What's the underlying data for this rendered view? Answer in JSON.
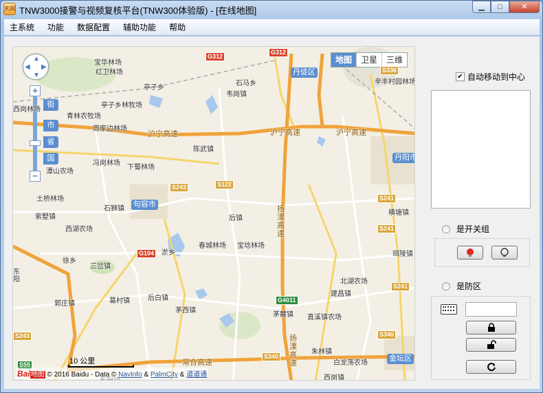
{
  "window": {
    "title": "TNW3000接警与视频复核平台(TNW300体验版) - [在线地图]",
    "app_icon_label": "天网",
    "controls": {
      "minimize": "▁",
      "maximize": "□",
      "close": "✕"
    }
  },
  "menu": [
    "主系统",
    "功能",
    "数据配置",
    "辅助功能",
    "帮助"
  ],
  "map": {
    "type_buttons": [
      "地图",
      "卫星",
      "三维"
    ],
    "active_type": "地图",
    "zoom_levels": [
      "街",
      "市",
      "省",
      "国"
    ],
    "zoom_in": "+",
    "zoom_out": "−",
    "scale_label": "10 公里",
    "copyright": {
      "logo": "Bai",
      "logo_suffix": "地图",
      "text": "© 2016 Baidu - Data ©",
      "links": [
        "NavInfo",
        "PalmCity",
        "道道通"
      ],
      "sep": "&"
    },
    "towns": [
      "丹徒区",
      "丹阳市",
      "句容市",
      "金坛区"
    ],
    "highways": [
      "沪宁高速",
      "沪宁高速",
      "沪宁高速",
      "扬溧高速",
      "扬溧高速",
      "常合高速"
    ],
    "road_shields": [
      "G312",
      "G312",
      "S336",
      "S243",
      "S122",
      "S241",
      "S241",
      "S241",
      "G104",
      "G4011",
      "S340",
      "S340",
      "S243",
      "S55"
    ],
    "places": [
      "宝华林场",
      "红卫林场",
      "亭子乡",
      "石马乡",
      "韦岗镇",
      "辛丰村园林场",
      "西岗林场",
      "亭子乡林牧场",
      "青林农牧场",
      "周家边林场",
      "陈武镇",
      "冯岗林场",
      "下蜀林场",
      "潭山农场",
      "土桥林场",
      "石狮镇",
      "索墅镇",
      "西湖农场",
      "后镇",
      "横塘镇",
      "春城林场",
      "宝埝林场",
      "淤乡",
      "三岔镇",
      "徐乡",
      "珥陵镇",
      "郭庄镇",
      "葛村镇",
      "后白镇",
      "茅西镇",
      "北湖农场",
      "建昌镇",
      "茅麓镇",
      "直溪镇农场",
      "朱林镇",
      "白龙荡农场",
      "西岗镇",
      "东阳镇",
      "东阳"
    ]
  },
  "side": {
    "auto_center_label": "自动移动到中心",
    "auto_center_checked": true,
    "switch_group_label": "是开关组",
    "defense_label": "是防区",
    "password_value": ""
  }
}
